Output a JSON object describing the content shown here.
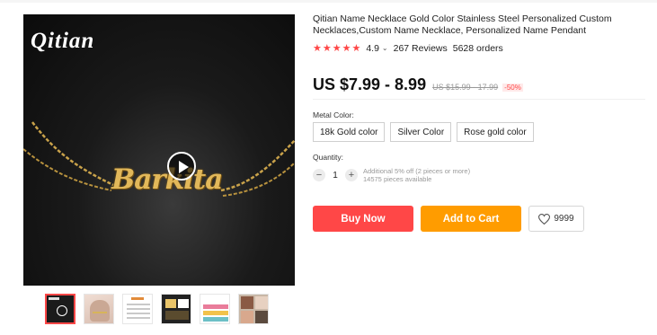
{
  "gallery": {
    "brand_logo": "Qitian",
    "pendant_text": "Barkita"
  },
  "product": {
    "title": "Qitian Name Necklace Gold Color Stainless Steel Personalized Custom Necklaces,Custom Name Necklace, Personalized Name Pendant",
    "rating": "4.9",
    "stars": "★★★★★",
    "reviews": "267 Reviews",
    "orders": "5628 orders"
  },
  "price": {
    "current": "US $7.99 - 8.99",
    "original": "US $15.99 - 17.99",
    "discount": "-50%"
  },
  "metal_color": {
    "label": "Metal Color:",
    "options": [
      "18k Gold color",
      "Silver Color",
      "Rose gold color"
    ]
  },
  "quantity": {
    "label": "Quantity:",
    "value": "1",
    "minus": "−",
    "plus": "+",
    "note_line1": "Additional 5% off (2 pieces or more)",
    "note_line2": "14575 pieces available"
  },
  "actions": {
    "buy_now": "Buy Now",
    "add_to_cart": "Add to Cart",
    "wishlist_count": "9999"
  },
  "colors": {
    "buy_now": "#ff4747",
    "add_to_cart": "#ff9c00",
    "stars": "#ff4747"
  }
}
